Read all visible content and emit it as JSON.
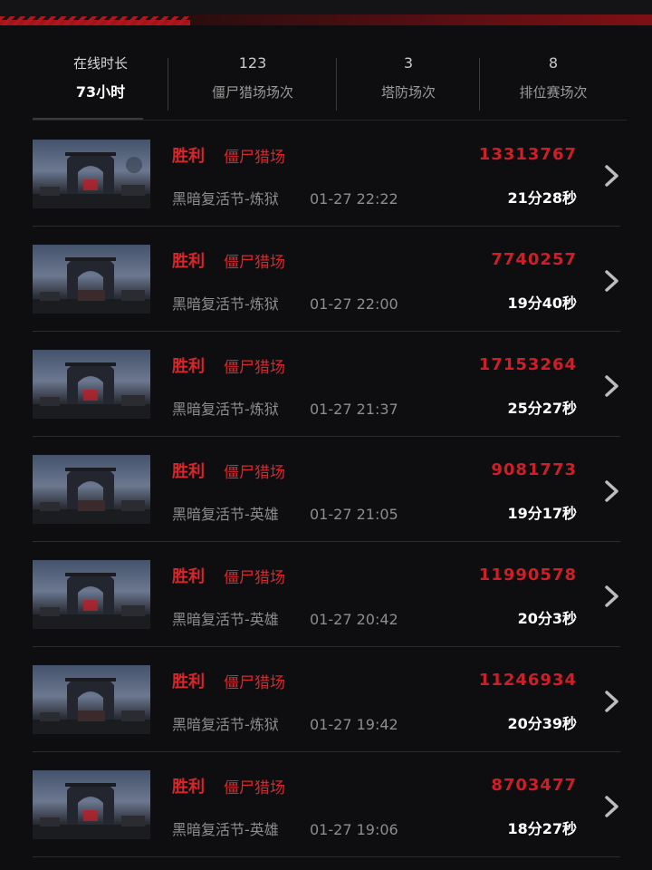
{
  "stats": [
    {
      "top": "在线时长",
      "bottom": "73小时",
      "active": true
    },
    {
      "top": "123",
      "bottom": "僵尸猎场场次",
      "active": false
    },
    {
      "top": "3",
      "bottom": "塔防场次",
      "active": false
    },
    {
      "top": "8",
      "bottom": "排位赛场次",
      "active": false
    }
  ],
  "matches": [
    {
      "result": "胜利",
      "mode": "僵尸猎场",
      "map": "黑暗复活节-炼狱",
      "time": "01-27 22:22",
      "score": "13313767",
      "duration": "21分28秒"
    },
    {
      "result": "胜利",
      "mode": "僵尸猎场",
      "map": "黑暗复活节-炼狱",
      "time": "01-27 22:00",
      "score": "7740257",
      "duration": "19分40秒"
    },
    {
      "result": "胜利",
      "mode": "僵尸猎场",
      "map": "黑暗复活节-炼狱",
      "time": "01-27 21:37",
      "score": "17153264",
      "duration": "25分27秒"
    },
    {
      "result": "胜利",
      "mode": "僵尸猎场",
      "map": "黑暗复活节-英雄",
      "time": "01-27 21:05",
      "score": "9081773",
      "duration": "19分17秒"
    },
    {
      "result": "胜利",
      "mode": "僵尸猎场",
      "map": "黑暗复活节-英雄",
      "time": "01-27 20:42",
      "score": "11990578",
      "duration": "20分3秒"
    },
    {
      "result": "胜利",
      "mode": "僵尸猎场",
      "map": "黑暗复活节-炼狱",
      "time": "01-27 19:42",
      "score": "11246934",
      "duration": "20分39秒"
    },
    {
      "result": "胜利",
      "mode": "僵尸猎场",
      "map": "黑暗复活节-英雄",
      "time": "01-27 19:06",
      "score": "8703477",
      "duration": "18分27秒"
    }
  ],
  "icons": {
    "row_arrow": "chevron-right-icon",
    "thumbnail": "map-thumbnail-arch"
  },
  "colors": {
    "accent_red": "#d8262d",
    "background": "#0e0e10",
    "header_red": "#a3141a"
  }
}
